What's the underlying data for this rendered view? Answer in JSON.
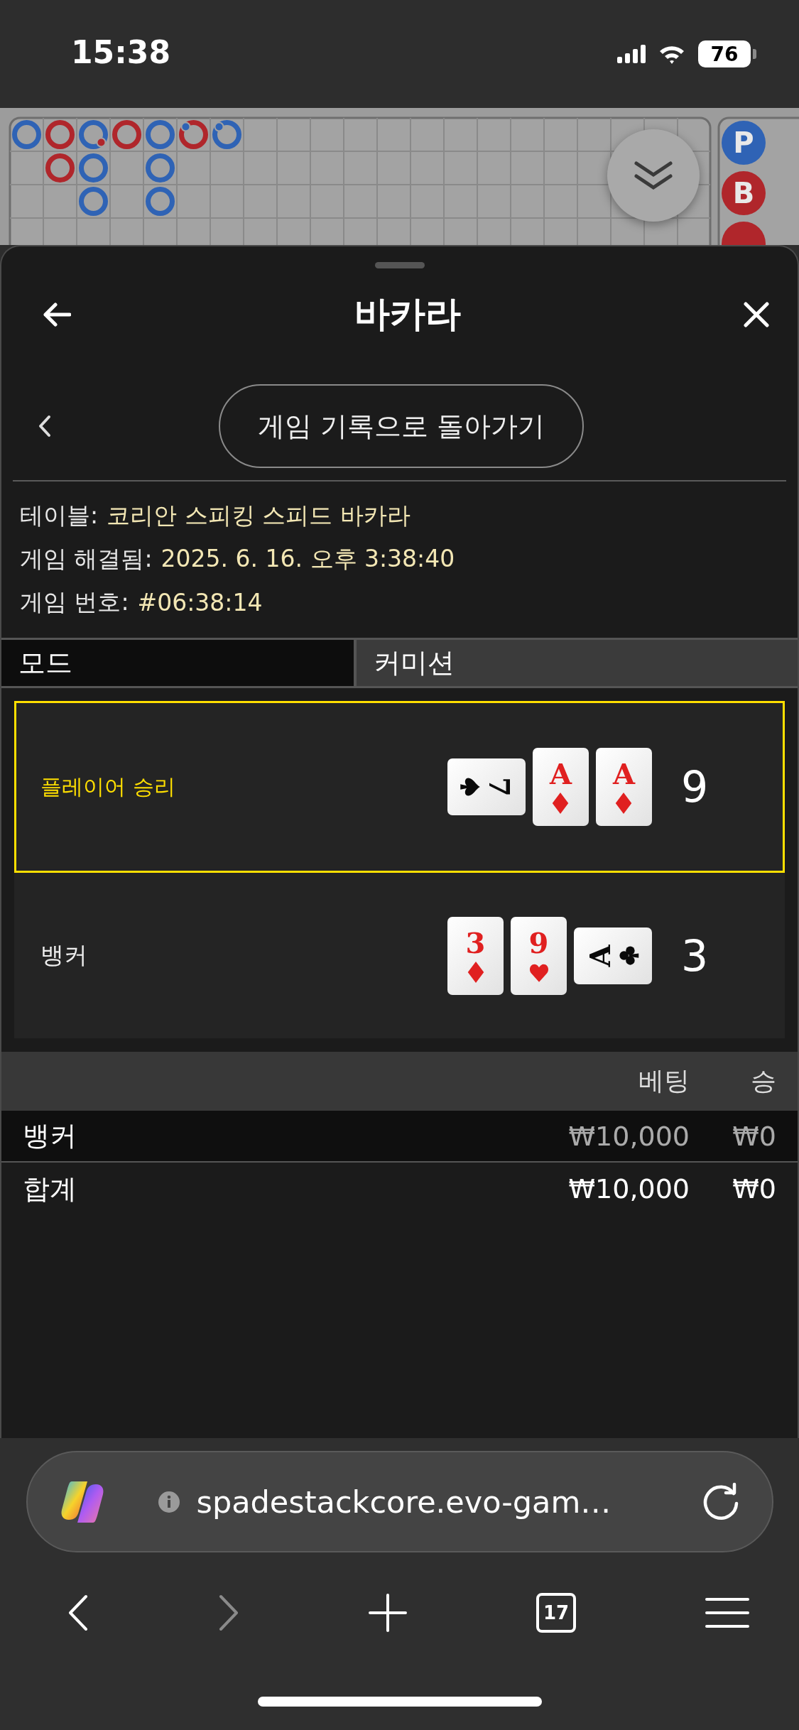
{
  "status_bar": {
    "time": "15:38",
    "battery": "76"
  },
  "roadmap": {
    "bead_columns": [
      [
        {
          "color": "#2f63b5"
        }
      ],
      [
        {
          "color": "#b0262b"
        },
        {
          "color": "#b0262b"
        }
      ],
      [
        {
          "color": "#2f63b5",
          "dot": {
            "color": "#b0262b",
            "kind": "lower"
          }
        },
        {
          "color": "#2f63b5"
        },
        {
          "color": "#2f63b5"
        }
      ],
      [
        {
          "color": "#b0262b"
        }
      ],
      [
        {
          "color": "#2f63b5"
        },
        {
          "color": "#2f63b5"
        },
        {
          "color": "#2f63b5"
        }
      ],
      [
        {
          "color": "#b0262b",
          "dot": {
            "color": "#2f63b5",
            "kind": "upper"
          }
        }
      ],
      [
        {
          "color": "#2f63b5",
          "dot": {
            "color": "#2f63b5",
            "kind": "upper"
          }
        }
      ]
    ],
    "side_beads": [
      {
        "label": "P",
        "color": "#2f63b5"
      },
      {
        "label": "B",
        "color": "#b0262b"
      },
      {
        "color": "#b0262b"
      }
    ]
  },
  "sheet": {
    "title": "바카라",
    "back_to_history": "게임 기록으로 돌아가기",
    "info": [
      {
        "label": "테이블:",
        "value": "코리안 스피킹 스피드 바카라"
      },
      {
        "label": "게임 해결됨:",
        "value": "2025. 6. 16. 오후 3:38:40"
      },
      {
        "label": "게임 번호:",
        "value": "#06:38:14"
      }
    ],
    "tabs": [
      {
        "label": "모드",
        "selected": true
      },
      {
        "label": "커미션",
        "selected": false
      }
    ],
    "hands": [
      {
        "label": "플레이어 승리",
        "winner": true,
        "score": "9",
        "cards": [
          {
            "rank": "7",
            "kind": "spade",
            "sideways": true,
            "clockwise": true
          },
          {
            "rank": "A",
            "kind": "diamond",
            "sideways": false
          },
          {
            "rank": "A",
            "kind": "diamond",
            "sideways": false
          }
        ]
      },
      {
        "label": "뱅커",
        "winner": false,
        "score": "3",
        "cards": [
          {
            "rank": "3",
            "kind": "diamond",
            "sideways": false
          },
          {
            "rank": "9",
            "kind": "heart",
            "sideways": false
          },
          {
            "rank": "A",
            "kind": "club",
            "sideways": true,
            "clockwise": false
          }
        ]
      }
    ],
    "bets": {
      "columns": [
        "베팅",
        "승"
      ],
      "rows": [
        {
          "name": "뱅커",
          "bet": "₩10,000",
          "win": "₩0",
          "kind": "bet"
        },
        {
          "name": "합계",
          "bet": "₩10,000",
          "win": "₩0",
          "kind": "total"
        }
      ]
    }
  },
  "browser": {
    "url": "spadestackcore.evo-gam…",
    "tab_count": "17"
  }
}
